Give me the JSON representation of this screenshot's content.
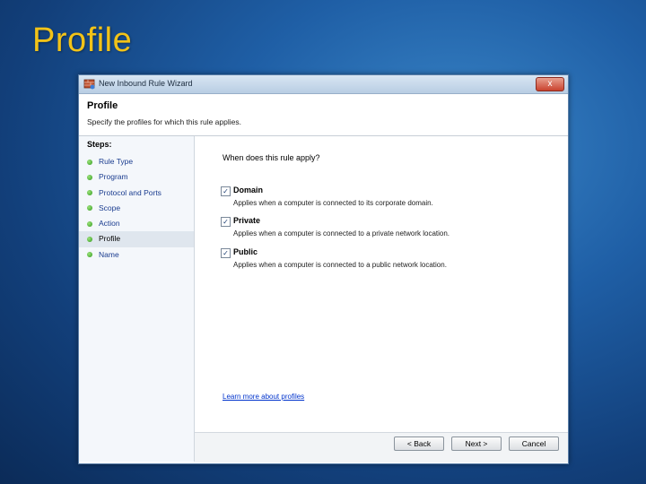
{
  "slide": {
    "title": "Profile"
  },
  "window": {
    "title": "New Inbound Rule Wizard",
    "close_label": "x"
  },
  "header": {
    "title": "Profile",
    "subtitle": "Specify the profiles for which this rule applies."
  },
  "steps": {
    "heading": "Steps:",
    "items": [
      {
        "label": "Rule Type"
      },
      {
        "label": "Program"
      },
      {
        "label": "Protocol and Ports"
      },
      {
        "label": "Scope"
      },
      {
        "label": "Action"
      },
      {
        "label": "Profile",
        "active": true
      },
      {
        "label": "Name"
      }
    ]
  },
  "content": {
    "question": "When does this rule apply?",
    "options": [
      {
        "label": "Domain",
        "checked": true,
        "description": "Applies when a computer is connected to its corporate domain."
      },
      {
        "label": "Private",
        "checked": true,
        "description": "Applies when a computer is connected to a private network location."
      },
      {
        "label": "Public",
        "checked": true,
        "description": "Applies when a computer is connected to a public network location."
      }
    ],
    "learn_more": "Learn more about profiles"
  },
  "footer": {
    "back_label": "< Back",
    "next_label": "Next >",
    "cancel_label": "Cancel"
  }
}
